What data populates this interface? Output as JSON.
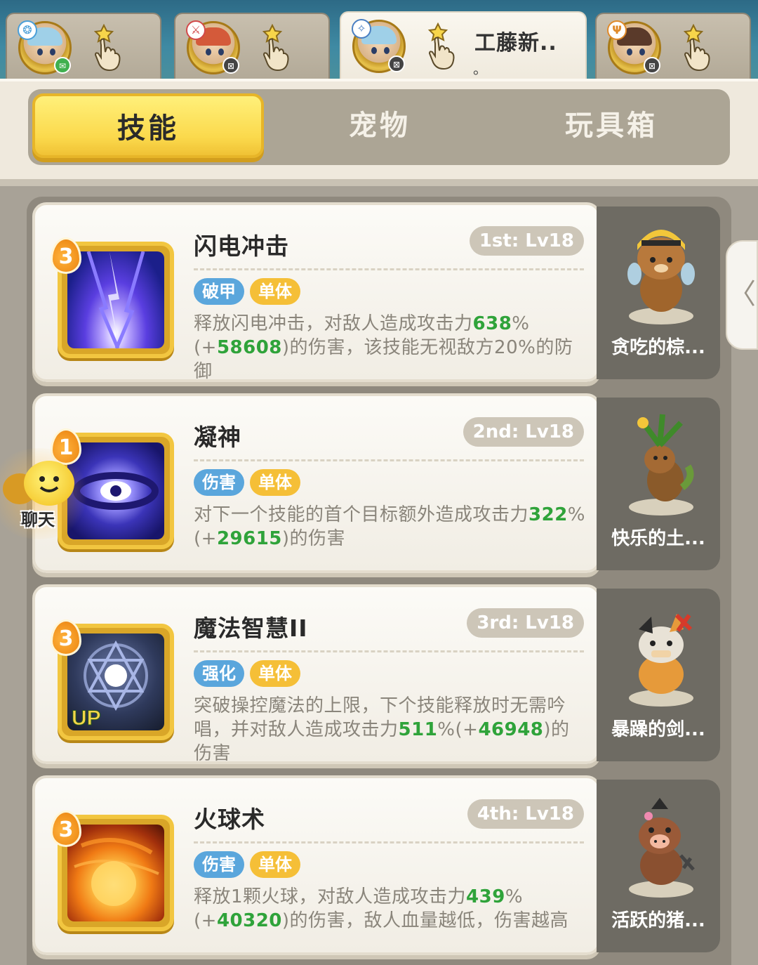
{
  "hero_tabs": [
    {
      "name": "",
      "sub": "",
      "status": "online",
      "badge_color": "#4a9fd8",
      "hair": "#9fd0e8",
      "status_color": "#3fb04f"
    },
    {
      "name": "",
      "sub": "",
      "status": "offline",
      "badge_color": "#d24a4a",
      "hair": "#d45a3a",
      "status_color": "#444444"
    },
    {
      "name": "工藤新..",
      "sub": "。",
      "status": "offline",
      "badge_color": "#4a7fc2",
      "hair": "#9fd0e8",
      "status_color": "#444444"
    },
    {
      "name": "",
      "sub": "",
      "status": "offline",
      "badge_color": "#e08a2a",
      "hair": "#5a3a2a",
      "status_color": "#444444"
    }
  ],
  "category_tabs": [
    "技能",
    "宠物",
    "玩具箱"
  ],
  "active_category": "技能",
  "skills": [
    {
      "title": "闪电冲击",
      "slot": "1st: Lv18",
      "level": "3",
      "tags": [
        "破甲",
        "单体"
      ],
      "desc_parts": [
        "释放闪电冲击，对敌人造成攻击力",
        "638",
        "%(+",
        "58608",
        ")的伤害，该技能无视敌方20%的防御"
      ],
      "pet_name": "贪吃的棕...",
      "icon_colors": [
        "#1b1f8a",
        "#6b49e6",
        "#d8d4ff"
      ]
    },
    {
      "title": "凝神",
      "slot": "2nd: Lv18",
      "level": "1",
      "tags": [
        "伤害",
        "单体"
      ],
      "desc_parts": [
        "对下一个技能的首个目标额外造成攻击力",
        "322",
        "%(+",
        "29615",
        ")的伤害"
      ],
      "pet_name": "快乐的土...",
      "icon_colors": [
        "#23207a",
        "#5b54d6",
        "#ffffff"
      ]
    },
    {
      "title": "魔法智慧II",
      "slot": "3rd: Lv18",
      "level": "3",
      "tags": [
        "强化",
        "单体"
      ],
      "desc_parts": [
        "突破操控魔法的上限，下个技能释放时无需吟唱，并对敌人造成攻击力",
        "511",
        "%(+",
        "46948",
        ")的伤害"
      ],
      "pet_name": "暴躁的剑...",
      "icon_colors": [
        "#1c2436",
        "#3d4d78",
        "#e8eeff"
      ]
    },
    {
      "title": "火球术",
      "slot": "4th: Lv18",
      "level": "3",
      "tags": [
        "伤害",
        "单体"
      ],
      "desc_parts": [
        "释放1颗火球，对敌人造成攻击力",
        "439",
        "%(+",
        "40320",
        ")的伤害，敌人血量越低，伤害越高"
      ],
      "pet_name": "活跃的猪...",
      "icon_colors": [
        "#6b1e08",
        "#f07a14",
        "#ffe38a"
      ]
    }
  ],
  "chat_label": "聊天",
  "icon_badge": "UP"
}
